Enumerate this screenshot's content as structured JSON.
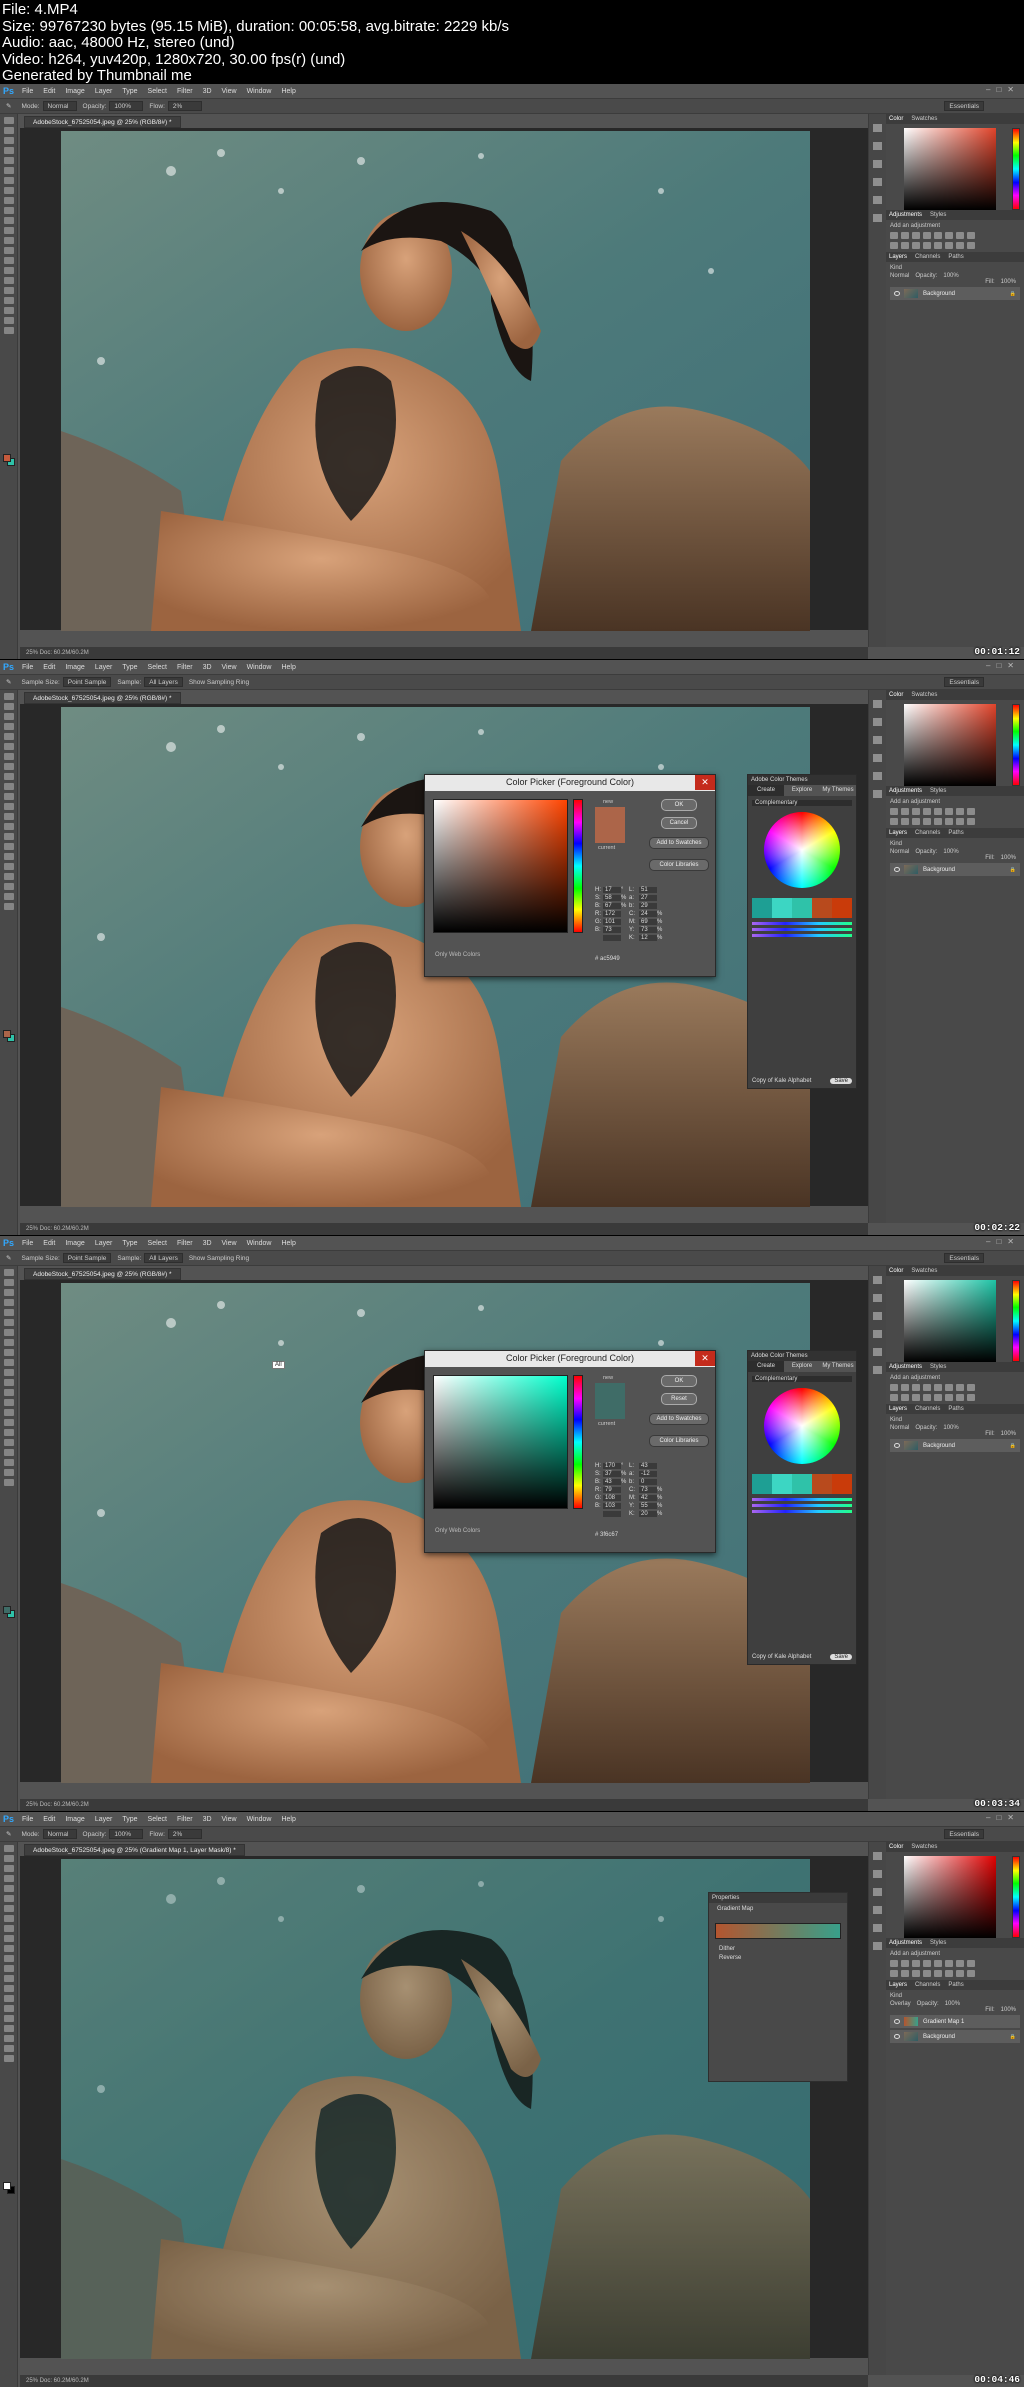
{
  "header": {
    "line1": "File: 4.MP4",
    "line2": "Size: 99767230 bytes (95.15 MiB), duration: 00:05:58, avg.bitrate: 2229 kb/s",
    "line3": "Audio: aac, 48000 Hz, stereo (und)",
    "line4": "Video: h264, yuv420p, 1280x720, 30.00 fps(r) (und)",
    "line5": "Generated by Thumbnail me"
  },
  "menu": [
    "File",
    "Edit",
    "Image",
    "Layer",
    "Type",
    "Select",
    "Filter",
    "3D",
    "View",
    "Window",
    "Help"
  ],
  "ps_logo": "Ps",
  "workspace": "Essentials",
  "panel_tabs": {
    "color": "Color",
    "swatches": "Swatches",
    "adjustments": "Adjustments",
    "styles": "Styles",
    "add_adjustment": "Add an adjustment",
    "layers": "Layers",
    "channels": "Channels",
    "paths": "Paths",
    "background_layer": "Background",
    "gradient_layer": "Gradient Map 1",
    "kind": "Kind",
    "normal": "Normal",
    "overlay": "Overlay",
    "opacity": "Opacity:",
    "opacity_value": "100%",
    "fill": "Fill:",
    "fill_value": "100%"
  },
  "frames": [
    {
      "timestamp": "00:01:12",
      "doc_tab": "AdobeStock_67525054.jpeg @ 25% (RGB/8#) *",
      "options": [
        "Mode:",
        "Normal",
        "Opacity:",
        "100%",
        "Flow:",
        "2%"
      ],
      "status": "25%     Doc: 60.2M/60.2M"
    },
    {
      "timestamp": "00:02:22",
      "doc_tab": "AdobeStock_67525054.jpeg @ 25% (RGB/8#) *",
      "options": [
        "Sample Size:",
        "Point Sample",
        "Sample:",
        "All Layers",
        "Show Sampling Ring"
      ],
      "status": "25%     Doc: 60.2M/60.2M",
      "picker": {
        "title": "Color Picker (Foreground Color)",
        "ok": "OK",
        "cancel": "Cancel",
        "add_swatch": "Add to Swatches",
        "libraries": "Color Libraries",
        "new_label": "new",
        "current_label": "current",
        "only_web": "Only Web Colors",
        "hex": "ac5949",
        "values": [
          [
            "H:",
            "17",
            "°",
            "L:",
            "51",
            ""
          ],
          [
            "S:",
            "58",
            "%",
            "a:",
            "27",
            ""
          ],
          [
            "B:",
            "67",
            "%",
            "b:",
            "29",
            ""
          ],
          [
            "R:",
            "172",
            "",
            "C:",
            "24",
            "%"
          ],
          [
            "G:",
            "101",
            "",
            "M:",
            "69",
            "%"
          ],
          [
            "B:",
            "73",
            "",
            "Y:",
            "73",
            "%"
          ],
          [
            "",
            "",
            "",
            "K:",
            "12",
            "%"
          ]
        ],
        "new_color": "#ac6549",
        "current_color": "#ac6549",
        "field_hue": "#ff4400"
      },
      "themes": {
        "title": "Adobe Color Themes",
        "tabs": [
          "Create",
          "Explore",
          "My Themes"
        ],
        "rule": "Complementary",
        "footer": "Copy of Kale Alphabet",
        "save": "Save",
        "swatches": [
          "#1e9f94",
          "#3cd6c3",
          "#2fc2a9",
          "#b84a1d",
          "#c93b0a"
        ]
      }
    },
    {
      "timestamp": "00:03:34",
      "doc_tab": "AdobeStock_67525054.jpeg @ 25% (RGB/8#) *",
      "options": [
        "Sample Size:",
        "Point Sample",
        "Sample:",
        "All Layers",
        "Show Sampling Ring"
      ],
      "status": "25%     Doc: 60.2M/60.2M",
      "tooltip": "All",
      "picker": {
        "title": "Color Picker (Foreground Color)",
        "ok": "OK",
        "cancel": "Reset",
        "add_swatch": "Add to Swatches",
        "libraries": "Color Libraries",
        "new_label": "new",
        "current_label": "current",
        "only_web": "Only Web Colors",
        "hex": "3f6c67",
        "values": [
          [
            "H:",
            "170",
            "°",
            "L:",
            "43",
            ""
          ],
          [
            "S:",
            "37",
            "%",
            "a:",
            "-12",
            ""
          ],
          [
            "B:",
            "43",
            "%",
            "b:",
            "0",
            ""
          ],
          [
            "R:",
            "79",
            "",
            "C:",
            "73",
            "%"
          ],
          [
            "G:",
            "108",
            "",
            "M:",
            "42",
            "%"
          ],
          [
            "B:",
            "103",
            "",
            "Y:",
            "55",
            "%"
          ],
          [
            "",
            "",
            "",
            "K:",
            "20",
            "%"
          ]
        ],
        "new_color": "#3f6c67",
        "current_color": "#3f6c67",
        "field_hue": "#00ffcc"
      },
      "themes": {
        "title": "Adobe Color Themes",
        "tabs": [
          "Create",
          "Explore",
          "My Themes"
        ],
        "rule": "Complementary",
        "footer": "Copy of Kale Alphabet",
        "save": "Save",
        "swatches": [
          "#1e9f94",
          "#3cd6c3",
          "#2fc2a9",
          "#b84a1d",
          "#c93b0a"
        ]
      }
    },
    {
      "timestamp": "00:04:46",
      "doc_tab": "AdobeStock_67525054.jpeg @ 25% (Gradient Map 1, Layer Mask/8) *",
      "options": [
        "Mode:",
        "Normal",
        "Opacity:",
        "100%",
        "Flow:",
        "2%"
      ],
      "status": "25%     Doc: 60.2M/60.2M",
      "properties": {
        "title": "Properties",
        "kind": "Gradient Map",
        "dither": "Dither",
        "reverse": "Reverse"
      }
    }
  ]
}
